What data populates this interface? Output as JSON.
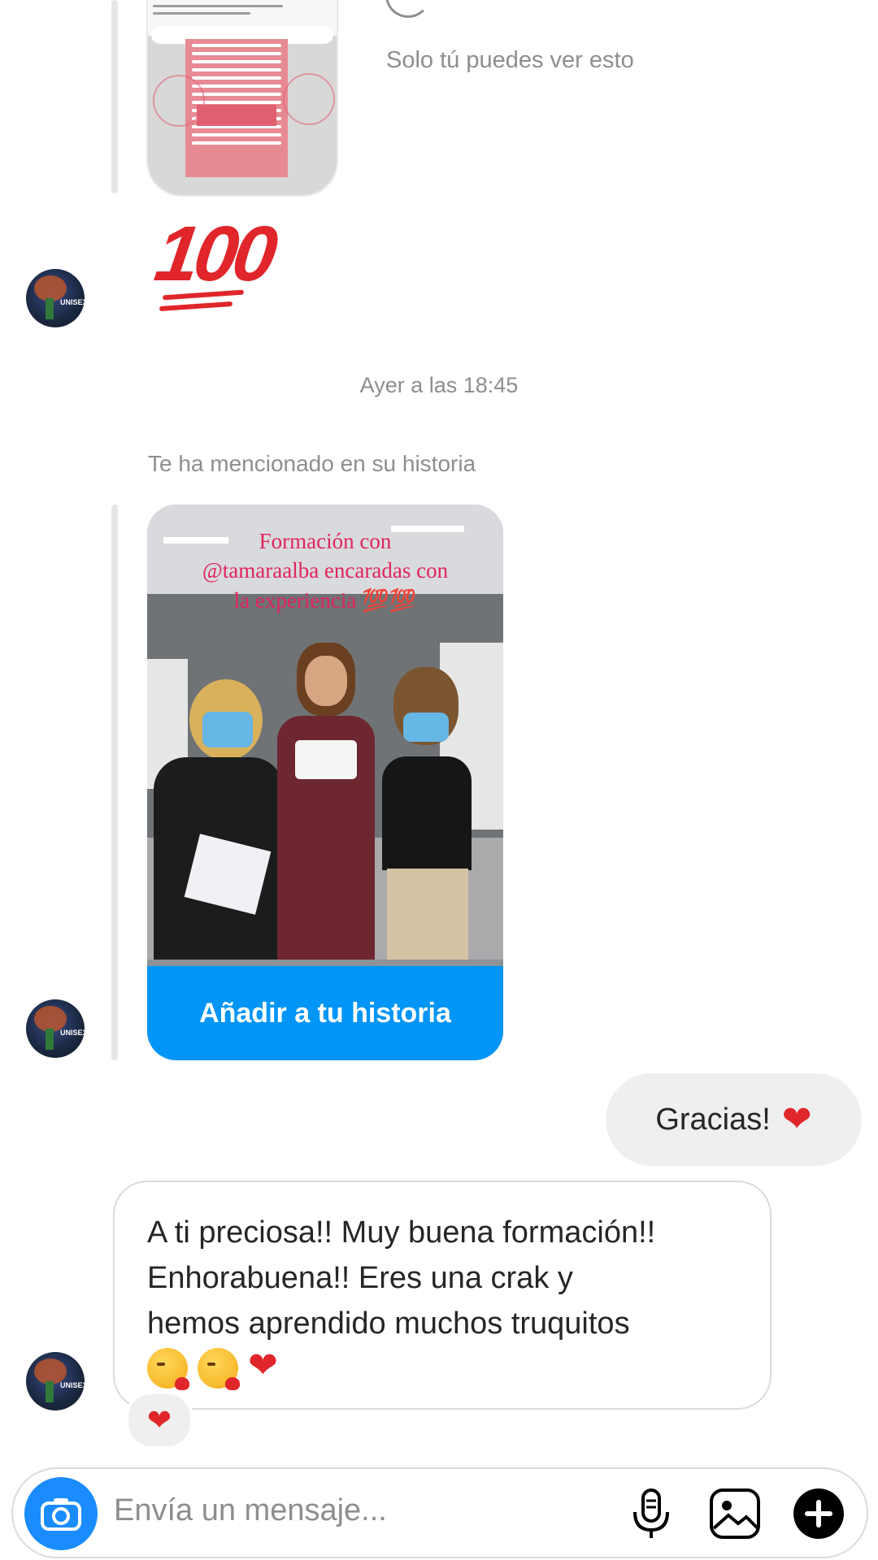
{
  "thread": {
    "story_reply_note": "Solo tú puedes ver esto",
    "emoji_100": "💯",
    "timestamp": "Ayer a las 18:45",
    "mention_label": "Te ha mencionado en su historia",
    "story_overlay_lines": [
      "Formación con",
      "@tamaraalba encaradas con",
      "la experiencia 💯💯"
    ],
    "add_story_button": "Añadir a tu historia",
    "outgoing_message": "Gracias!",
    "incoming_message_lines": [
      "A ti preciosa!! Muy buena formación!!",
      "Enhorabuena!! Eres una crak y",
      "hemos aprendido muchos truquitos"
    ],
    "reaction": "heart"
  },
  "composer": {
    "placeholder": "Envía un mensaje...",
    "icons": [
      "camera-icon",
      "microphone-icon",
      "gallery-icon",
      "plus-icon"
    ]
  },
  "colors": {
    "accent_blue": "#0095f6",
    "camera_blue": "#1a8cff",
    "heart_red": "#e0262a",
    "muted_text": "#8e8e8e",
    "bubble_gray": "#efefef"
  }
}
